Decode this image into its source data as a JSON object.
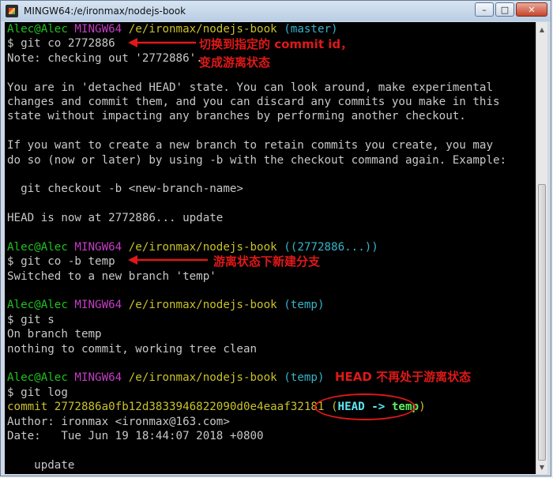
{
  "window": {
    "title": "MINGW64:/e/ironmax/nodejs-book"
  },
  "controls": {
    "minimize": "–",
    "maximize": "□",
    "close": "✕"
  },
  "colors": {
    "prompt_user": "#1fc21f",
    "prompt_system": "#c63cc6",
    "prompt_path": "#c9c12a",
    "prompt_branch": "#35b5c9",
    "annotation": "#e01818"
  },
  "terminal": {
    "lines": [
      [
        {
          "t": "Alec@Alec ",
          "c": "green"
        },
        {
          "t": "MINGW64 ",
          "c": "magenta"
        },
        {
          "t": "/e/ironmax/nodejs-book ",
          "c": "yellow"
        },
        {
          "t": "(master)",
          "c": "cyan"
        }
      ],
      [
        {
          "t": "$ git co 2772886"
        }
      ],
      [
        {
          "t": "Note: checking out '2772886'."
        }
      ],
      [
        {
          "t": ""
        }
      ],
      [
        {
          "t": "You are in 'detached HEAD' state. You can look around, make experimental"
        }
      ],
      [
        {
          "t": "changes and commit them, and you can discard any commits you make in this"
        }
      ],
      [
        {
          "t": "state without impacting any branches by performing another checkout."
        }
      ],
      [
        {
          "t": ""
        }
      ],
      [
        {
          "t": "If you want to create a new branch to retain commits you create, you may"
        }
      ],
      [
        {
          "t": "do so (now or later) by using -b with the checkout command again. Example:"
        }
      ],
      [
        {
          "t": ""
        }
      ],
      [
        {
          "t": "  git checkout -b <new-branch-name>"
        }
      ],
      [
        {
          "t": ""
        }
      ],
      [
        {
          "t": "HEAD is now at 2772886... update"
        }
      ],
      [
        {
          "t": ""
        }
      ],
      [
        {
          "t": "Alec@Alec ",
          "c": "green"
        },
        {
          "t": "MINGW64 ",
          "c": "magenta"
        },
        {
          "t": "/e/ironmax/nodejs-book ",
          "c": "yellow"
        },
        {
          "t": "((2772886...))",
          "c": "cyan"
        }
      ],
      [
        {
          "t": "$ git co -b temp"
        }
      ],
      [
        {
          "t": "Switched to a new branch 'temp'"
        }
      ],
      [
        {
          "t": ""
        }
      ],
      [
        {
          "t": "Alec@Alec ",
          "c": "green"
        },
        {
          "t": "MINGW64 ",
          "c": "magenta"
        },
        {
          "t": "/e/ironmax/nodejs-book ",
          "c": "yellow"
        },
        {
          "t": "(temp)",
          "c": "cyan"
        }
      ],
      [
        {
          "t": "$ git s"
        }
      ],
      [
        {
          "t": "On branch temp"
        }
      ],
      [
        {
          "t": "nothing to commit, working tree clean"
        }
      ],
      [
        {
          "t": ""
        }
      ],
      [
        {
          "t": "Alec@Alec ",
          "c": "green"
        },
        {
          "t": "MINGW64 ",
          "c": "magenta"
        },
        {
          "t": "/e/ironmax/nodejs-book ",
          "c": "yellow"
        },
        {
          "t": "(temp)",
          "c": "cyan"
        }
      ],
      [
        {
          "t": "$ git log"
        }
      ],
      [
        {
          "t": "commit 2772886a0fb12d3833946822090d0e4eaaf32181 ",
          "c": "yellow"
        },
        {
          "t": "(",
          "c": "yellow"
        },
        {
          "t": "HEAD -> ",
          "c": "cyanb"
        },
        {
          "t": "temp",
          "c": "greenb"
        },
        {
          "t": ")",
          "c": "yellow"
        }
      ],
      [
        {
          "t": "Author: ironmax <ironmax@163.com>"
        }
      ],
      [
        {
          "t": "Date:   Tue Jun 19 18:44:07 2018 +0800"
        }
      ],
      [
        {
          "t": ""
        }
      ],
      [
        {
          "t": "    update"
        }
      ]
    ]
  },
  "annotations": {
    "checkout_line1": "切换到指定的 commit id，",
    "checkout_line2": "变成游离状态",
    "new_branch": "游离状态下新建分支",
    "head_state": "HEAD 不再处于游离状态"
  }
}
